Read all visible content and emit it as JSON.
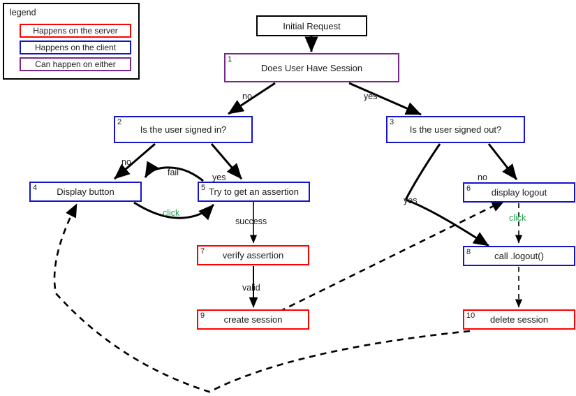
{
  "legend": {
    "title": "legend",
    "rows": [
      {
        "label": "Happens on the server",
        "color": "#ff0000"
      },
      {
        "label": "Happens on the client",
        "color": "#1414c8"
      },
      {
        "label": "Can happen on either",
        "color": "#78288c"
      }
    ]
  },
  "nodes": [
    {
      "num": "",
      "label": "Initial Request",
      "kind": "plain"
    },
    {
      "num": "1",
      "label": "Does User Have Session",
      "kind": "either"
    },
    {
      "num": "2",
      "label": "Is the user signed in?",
      "kind": "client"
    },
    {
      "num": "3",
      "label": "Is the user signed out?",
      "kind": "client"
    },
    {
      "num": "4",
      "label": "Display button",
      "kind": "client"
    },
    {
      "num": "5",
      "label": "Try to get an assertion",
      "kind": "client"
    },
    {
      "num": "6",
      "label": "display logout",
      "kind": "client"
    },
    {
      "num": "7",
      "label": "verify assertion",
      "kind": "server"
    },
    {
      "num": "8",
      "label": "call .logout()",
      "kind": "client"
    },
    {
      "num": "9",
      "label": "create session",
      "kind": "server"
    },
    {
      "num": "10",
      "label": "delete session",
      "kind": "server"
    }
  ],
  "edge_labels": [
    {
      "text": "no",
      "style": "plain"
    },
    {
      "text": "yes",
      "style": "plain"
    },
    {
      "text": "no",
      "style": "plain"
    },
    {
      "text": "yes",
      "style": "plain"
    },
    {
      "text": "yes",
      "style": "plain"
    },
    {
      "text": "no",
      "style": "plain"
    },
    {
      "text": "fail",
      "style": "plain"
    },
    {
      "text": "click",
      "style": "green"
    },
    {
      "text": "success",
      "style": "plain"
    },
    {
      "text": "valid",
      "style": "plain"
    },
    {
      "text": "click",
      "style": "green"
    }
  ],
  "colors": {
    "server": "#ff0000",
    "client": "#1414c8",
    "either": "#78288c",
    "plain": "#000000",
    "click_label": "#19a04b",
    "background": "#ffffff"
  },
  "chart_data": {
    "type": "diagram",
    "title": "Persona sign-in / sign-out flow",
    "nodes": [
      {
        "id": "start",
        "num": "",
        "label": "Initial Request",
        "where": "either-plain"
      },
      {
        "id": "n1",
        "num": "1",
        "label": "Does User Have Session",
        "where": "either"
      },
      {
        "id": "n2",
        "num": "2",
        "label": "Is the user signed in?",
        "where": "client"
      },
      {
        "id": "n3",
        "num": "3",
        "label": "Is the user signed out?",
        "where": "client"
      },
      {
        "id": "n4",
        "num": "4",
        "label": "Display button",
        "where": "client"
      },
      {
        "id": "n5",
        "num": "5",
        "label": "Try to get an assertion",
        "where": "client"
      },
      {
        "id": "n6",
        "num": "6",
        "label": "display logout",
        "where": "client"
      },
      {
        "id": "n7",
        "num": "7",
        "label": "verify assertion",
        "where": "server"
      },
      {
        "id": "n8",
        "num": "8",
        "label": "call .logout()",
        "where": "client"
      },
      {
        "id": "n9",
        "num": "9",
        "label": "create session",
        "where": "server"
      },
      {
        "id": "n10",
        "num": "10",
        "label": "delete session",
        "where": "server"
      }
    ],
    "edges": [
      {
        "from": "start",
        "to": "n1",
        "label": "",
        "dashed": false
      },
      {
        "from": "n1",
        "to": "n2",
        "label": "no",
        "dashed": false
      },
      {
        "from": "n1",
        "to": "n3",
        "label": "yes",
        "dashed": false
      },
      {
        "from": "n2",
        "to": "n4",
        "label": "no",
        "dashed": false
      },
      {
        "from": "n2",
        "to": "n5",
        "label": "yes",
        "dashed": false
      },
      {
        "from": "n5",
        "to": "n4",
        "label": "fail",
        "dashed": false
      },
      {
        "from": "n4",
        "to": "n5",
        "label": "click",
        "dashed": false
      },
      {
        "from": "n5",
        "to": "n7",
        "label": "success",
        "dashed": false
      },
      {
        "from": "n7",
        "to": "n9",
        "label": "valid",
        "dashed": false
      },
      {
        "from": "n3",
        "to": "n6",
        "label": "no",
        "dashed": false
      },
      {
        "from": "n3",
        "to": "n8",
        "label": "yes",
        "dashed": false
      },
      {
        "from": "n6",
        "to": "n8",
        "label": "click",
        "dashed": true
      },
      {
        "from": "n8",
        "to": "n10",
        "label": "",
        "dashed": true
      },
      {
        "from": "n9",
        "to": "n6",
        "label": "",
        "dashed": true
      },
      {
        "from": "n10",
        "to": "n4",
        "label": "",
        "dashed": true
      }
    ]
  }
}
